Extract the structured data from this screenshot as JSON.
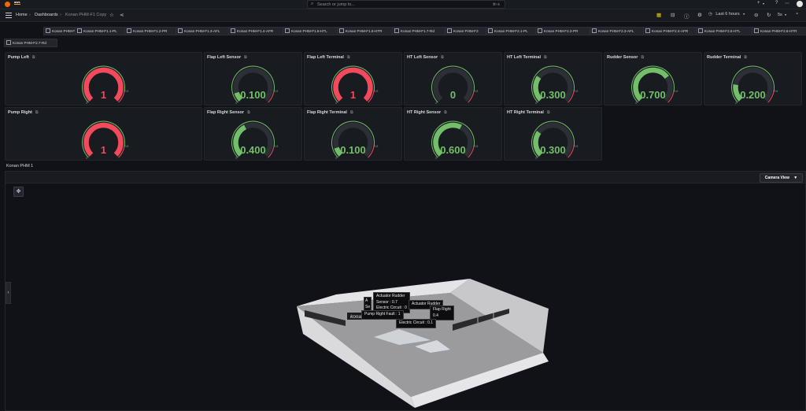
{
  "topbar": {
    "aws_label": "aws",
    "search_placeholder": "Search or jump to...",
    "search_shortcut": "⌘+k",
    "add_label": "+",
    "help_label": "?",
    "news_label": "⋯"
  },
  "breadcrumb": {
    "home": "Home",
    "sep": "›",
    "dashboards": "Dashboards",
    "current": "Konan PHM-F1 Copy"
  },
  "toolbar": {
    "time_range": "Last 6 hours",
    "refresh_interval": "5s"
  },
  "variables": [
    "Konan PHM-F1",
    "Konan PHM-F1.1-PL",
    "Konan PHM-F1.2-PR",
    "Konan PHM-F1.3-AFL",
    "Konan PHM-F1.4-AFR",
    "Konan PHM-F1.5-HTL",
    "Konan PHM-F1.6-HTR",
    "Konan PHM-F1.7-Rd",
    "Konan PHM-F2",
    "Konan PHM-F2.1-PL",
    "Konan PHM-F2.2-PR",
    "Konan PHM-F2.3-AFL",
    "Konan PHM-F2.4-AFR",
    "Konan PHM-F2.5-HTL",
    "Konan PHM-F2.6-HTR",
    "Konan PHM-F2.7-Rd"
  ],
  "gauge_scale": {
    "min": "0",
    "max": "0.8"
  },
  "panels": [
    {
      "title": "Pump Left",
      "value": "1",
      "fill": 1.0,
      "color": "#f2495c"
    },
    {
      "title": "Flap Left Sensor",
      "value": "0.100",
      "fill": 0.1,
      "color": "#73bf69"
    },
    {
      "title": "Flap Left Terminal",
      "value": "1",
      "fill": 1.0,
      "color": "#f2495c"
    },
    {
      "title": "HT Left Sensor",
      "value": "0",
      "fill": 0.0,
      "color": "#73bf69"
    },
    {
      "title": "HT Left Terminal",
      "value": "0.300",
      "fill": 0.3,
      "color": "#73bf69"
    },
    {
      "title": "Rudder Sensor",
      "value": "0.700",
      "fill": 0.7,
      "color": "#73bf69"
    },
    {
      "title": "Rudder Terminal",
      "value": "0.200",
      "fill": 0.2,
      "color": "#73bf69"
    },
    {
      "title": "Pump Right",
      "value": "1",
      "fill": 1.0,
      "color": "#f2495c"
    },
    {
      "title": "Flap Right Sensor",
      "value": "0.400",
      "fill": 0.4,
      "color": "#73bf69"
    },
    {
      "title": "Flap Right Terminal",
      "value": "0.100",
      "fill": 0.1,
      "color": "#73bf69"
    },
    {
      "title": "HT Right Sensor",
      "value": "0.600",
      "fill": 0.6,
      "color": "#73bf69"
    },
    {
      "title": "HT Right Terminal",
      "value": "0.300",
      "fill": 0.3,
      "color": "#73bf69"
    }
  ],
  "row_title": "Konan PHM 1",
  "scene": {
    "camera_button": "Camera View",
    "sign_text": "konan",
    "tooltips": {
      "rudder_name": "Actuator Rudder",
      "rudder_sensor": "Sensor : 0.7",
      "rudder_circuit": "Electric Circuit : 0",
      "pump_right": "Pump Right Fault : 1",
      "second_rudder_name": "Actuator Rudder",
      "flap_right_name": "Flap Right",
      "flap_right_sensor": "0.4",
      "flap_right_circuit": "Electric Circuit : 0.1",
      "partial_a": "A",
      "partial_se": "Se"
    }
  }
}
